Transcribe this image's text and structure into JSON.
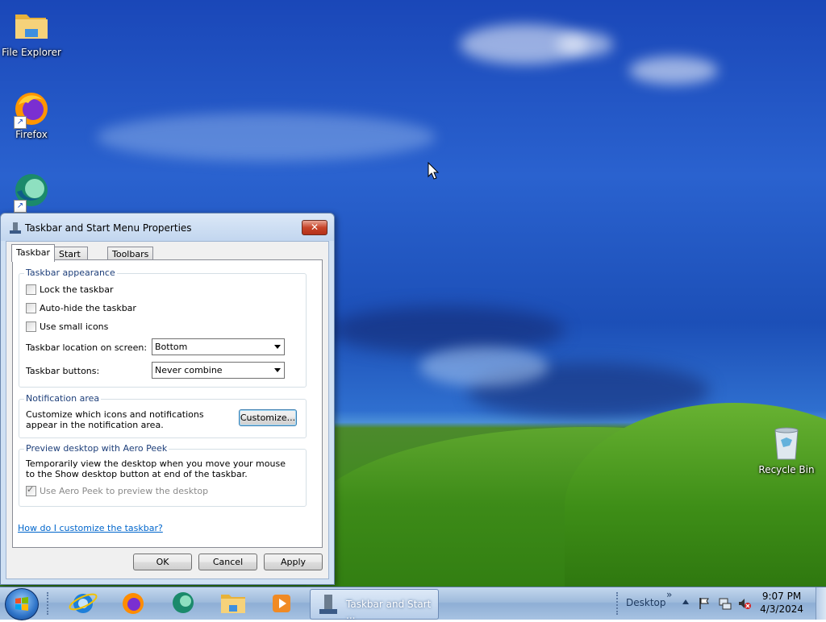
{
  "desktop": {
    "icons": [
      {
        "label": "File Explorer"
      },
      {
        "label": "Firefox"
      },
      {
        "label": "Recycle Bin"
      }
    ]
  },
  "dialog": {
    "title": "Taskbar and Start Menu Properties",
    "close_label": "✕",
    "tabs": [
      {
        "label": "Taskbar",
        "active": true
      },
      {
        "label": "Start Menu",
        "active": false
      },
      {
        "label": "Toolbars",
        "active": false
      }
    ],
    "appearance": {
      "legend": "Taskbar appearance",
      "lock": {
        "label": "Lock the taskbar",
        "checked": false
      },
      "autohide": {
        "label": "Auto-hide the taskbar",
        "checked": false
      },
      "small_icons": {
        "label": "Use small icons",
        "checked": false
      },
      "location_label": "Taskbar location on screen:",
      "location_value": "Bottom",
      "buttons_label": "Taskbar buttons:",
      "buttons_value": "Never combine"
    },
    "notification": {
      "legend": "Notification area",
      "description": "Customize which icons and notifications appear in the notification area.",
      "customize_label": "Customize..."
    },
    "aero_peek": {
      "legend": "Preview desktop with Aero Peek",
      "description": "Temporarily view the desktop when you move your mouse to the Show desktop button at end of the taskbar.",
      "checkbox": {
        "label": "Use Aero Peek to preview the desktop",
        "checked": true,
        "disabled": true
      }
    },
    "help_link": "How do I customize the taskbar?",
    "buttons": {
      "ok": "OK",
      "cancel": "Cancel",
      "apply": "Apply"
    }
  },
  "taskbar": {
    "pinned": [
      "internet-explorer-icon",
      "firefox-icon",
      "browser-app-icon",
      "file-explorer-icon",
      "media-player-icon"
    ],
    "active_task": "Taskbar and Start ...",
    "toolbar_label": "Desktop",
    "toolbar_chevron": "»",
    "clock": {
      "time": "9:07 PM",
      "date": "4/3/2024"
    }
  }
}
